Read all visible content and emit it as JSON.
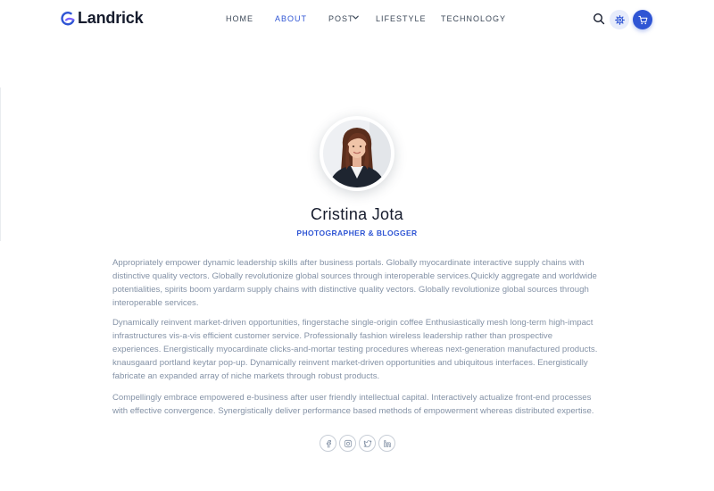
{
  "header": {
    "logo_text": "Landrick",
    "nav": [
      {
        "label": "HOME",
        "active": false
      },
      {
        "label": "ABOUT",
        "active": true
      },
      {
        "label": "POST",
        "active": false,
        "has_dropdown": true
      },
      {
        "label": "LIFESTYLE",
        "active": false
      },
      {
        "label": "TECHNOLOGY",
        "active": false
      }
    ]
  },
  "profile": {
    "name": "Cristina Jota",
    "role": "PHOTOGRAPHER & BLOGGER"
  },
  "bio": [
    "Appropriately empower dynamic leadership skills after business portals. Globally myocardinate interactive supply chains with distinctive quality vectors. Globally revolutionize global sources through interoperable services.Quickly aggregate and worldwide potentialities, spirits boom yardarm supply chains with distinctive quality vectors. Globally revolutionize global sources through interoperable services.",
    "Dynamically reinvent market-driven opportunities, fingerstache single-origin coffee Enthusiastically mesh long-term high-impact infrastructures vis-a-vis efficient customer service. Professionally fashion wireless leadership rather than prospective experiences. Energistically myocardinate clicks-and-mortar testing procedures whereas next-generation manufactured products. knausgaard portland keytar pop-up. Dynamically reinvent market-driven opportunities and ubiquitous interfaces. Energistically fabricate an expanded array of niche markets through robust products.",
    "Compellingly embrace empowered e-business after user friendly intellectual capital. Interactively actualize front-end processes with effective convergence. Synergistically deliver performance based methods of empowerment whereas distributed expertise."
  ],
  "social": [
    {
      "icon": "facebook-icon"
    },
    {
      "icon": "instagram-icon"
    },
    {
      "icon": "twitter-icon"
    },
    {
      "icon": "linkedin-icon"
    }
  ],
  "colors": {
    "primary": "#2f55d4",
    "heading": "#161c2d",
    "muted": "#8492a6"
  }
}
